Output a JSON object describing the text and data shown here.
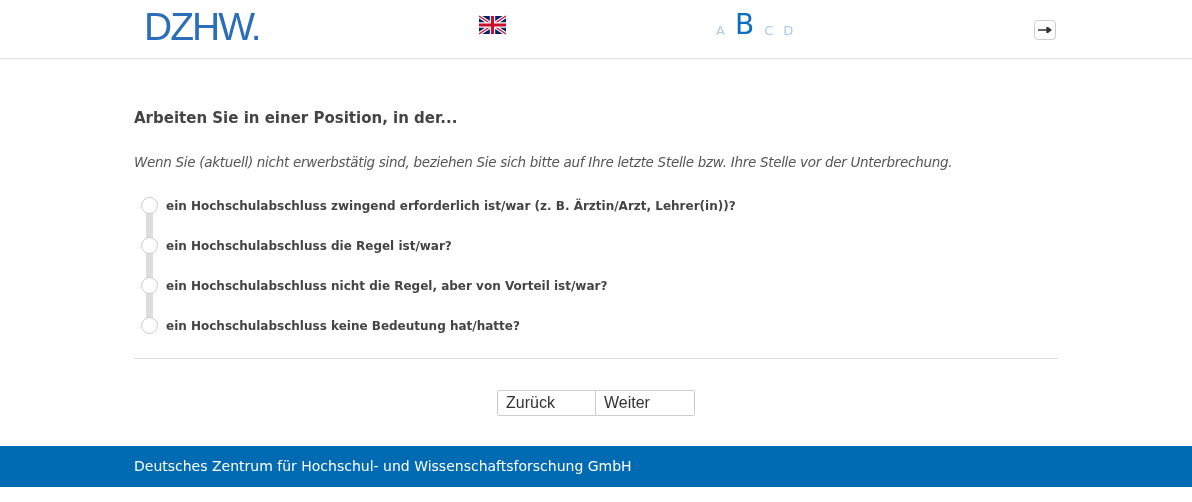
{
  "header": {
    "logo": "DZHW.",
    "versions": [
      {
        "label": "A",
        "selected": false
      },
      {
        "label": "B",
        "selected": true
      },
      {
        "label": "C",
        "selected": false
      },
      {
        "label": "D",
        "selected": false
      }
    ]
  },
  "question": {
    "title": "Arbeiten Sie in einer Position, in der...",
    "instruction": "Wenn Sie (aktuell) nicht erwerbstätig sind, beziehen Sie sich bitte auf Ihre letzte Stelle bzw. Ihre Stelle vor der Unterbrechung.",
    "options": [
      {
        "label": "ein Hochschulabschluss zwingend erforderlich ist/war (z.  B. Ärztin/Arzt, Lehrer(in))?",
        "selected": false
      },
      {
        "label": "ein Hochschulabschluss die Regel ist/war?",
        "selected": false
      },
      {
        "label": "ein Hochschulabschluss nicht die Regel, aber von Vorteil ist/war?",
        "selected": false
      },
      {
        "label": "ein Hochschulabschluss keine Bedeutung hat/hatte?",
        "selected": false
      }
    ]
  },
  "buttons": [
    "Zurück",
    "Weiter"
  ],
  "footer": "Deutsches Zentrum für Hochschul- und Wissenschaftsforschung GmbH"
}
